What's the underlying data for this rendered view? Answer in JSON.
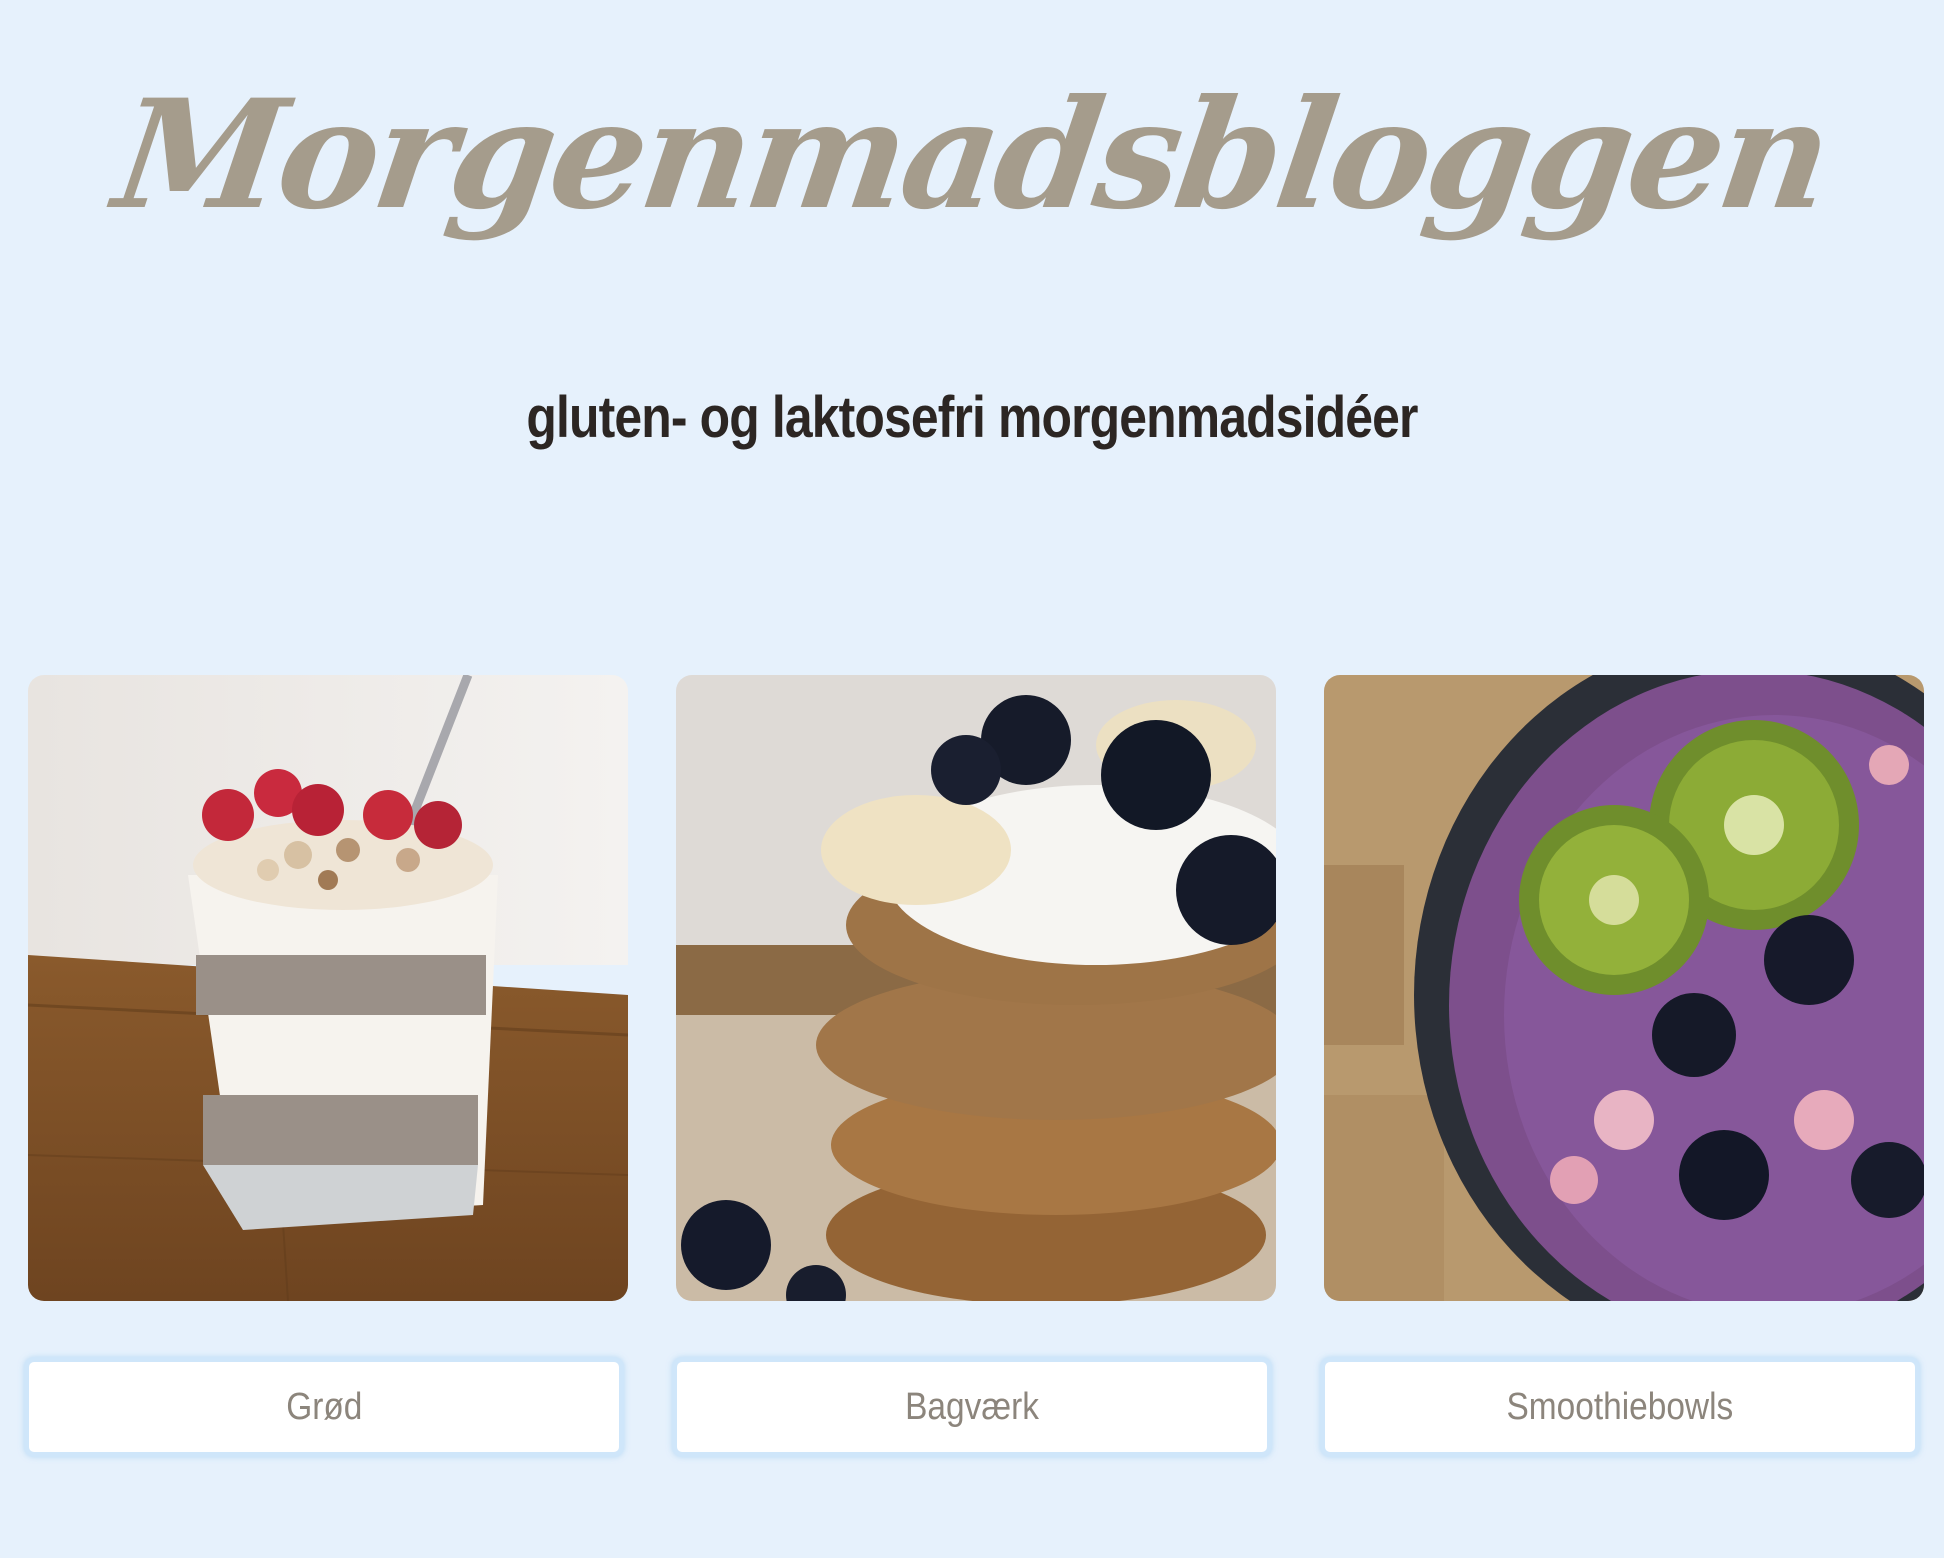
{
  "header": {
    "site_title": "Morgenmadsbloggen",
    "tagline": "gluten- og laktosefri morgenmadsidéer"
  },
  "categories": [
    {
      "label": "Grød",
      "image": "chia-pudding-glass-with-raspberries-photo"
    },
    {
      "label": "Bagværk",
      "image": "pancake-stack-with-yogurt-banana-blueberries-photo"
    },
    {
      "label": "Smoothiebowls",
      "image": "berry-smoothie-bowl-with-kiwi-photo"
    }
  ],
  "colors": {
    "background": "#e6f1fc",
    "title": "#a59c8c",
    "tagline": "#2c2623",
    "button_text": "#8c857c",
    "button_border": "#cfe6fa"
  }
}
